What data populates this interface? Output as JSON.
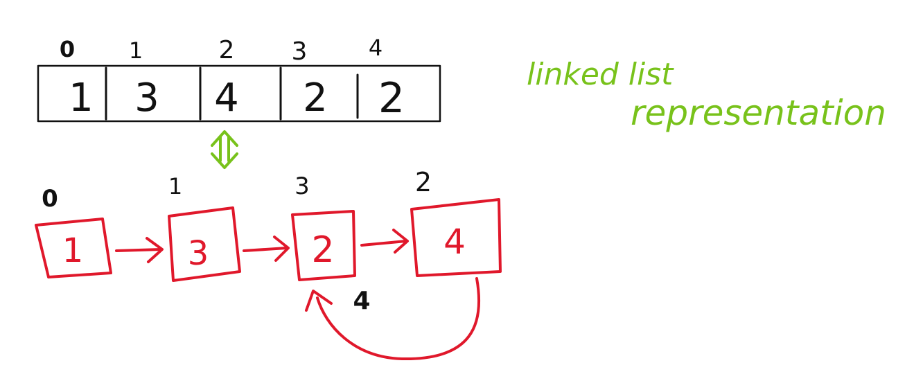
{
  "array": {
    "indices": [
      "0",
      "1",
      "2",
      "3",
      "4"
    ],
    "values": [
      "1",
      "3",
      "4",
      "2",
      "2"
    ]
  },
  "linked_list": {
    "nodes": [
      {
        "label": "0",
        "value": "1"
      },
      {
        "label": "1",
        "value": "3"
      },
      {
        "label": "3",
        "value": "2"
      },
      {
        "label": "2",
        "value": "4"
      }
    ],
    "back_edge_label": "4"
  },
  "note": {
    "line1": "linked list",
    "line2": "representation"
  },
  "colors": {
    "array_ink": "#111111",
    "list_ink": "#e0182b",
    "note_ink": "#78c21b"
  },
  "icons": {
    "equivalence": "double-arrow-icon"
  }
}
